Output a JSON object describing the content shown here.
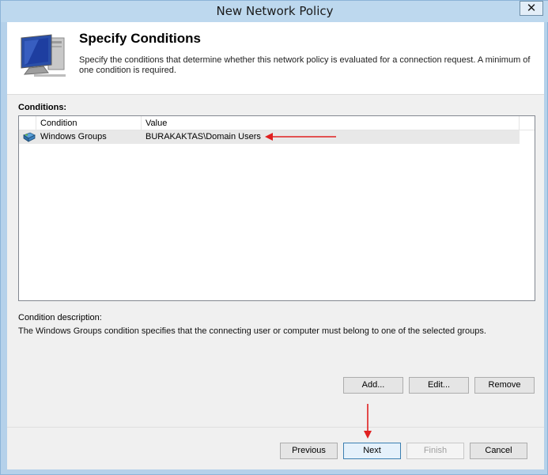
{
  "window": {
    "title": "New Network Policy",
    "close_glyph": "✕"
  },
  "header": {
    "title": "Specify Conditions",
    "description": "Specify the conditions that determine whether this network policy is evaluated for a connection request. A minimum of one condition is required.",
    "icon": "computer-monitor-icon"
  },
  "conditions": {
    "label": "Conditions:",
    "columns": [
      "Condition",
      "Value"
    ],
    "rows": [
      {
        "icon": "group-icon",
        "condition": "Windows Groups",
        "value": "BURAKAKTAS\\Domain Users"
      }
    ]
  },
  "description": {
    "label": "Condition description:",
    "text": "The Windows Groups condition specifies that the connecting user or computer must belong to one of the selected groups."
  },
  "buttons": {
    "add": "Add...",
    "edit": "Edit...",
    "remove": "Remove",
    "previous": "Previous",
    "next": "Next",
    "finish": "Finish",
    "cancel": "Cancel"
  },
  "colors": {
    "annotation_arrow": "#e02020",
    "title_bar": "#bdd8ee"
  }
}
